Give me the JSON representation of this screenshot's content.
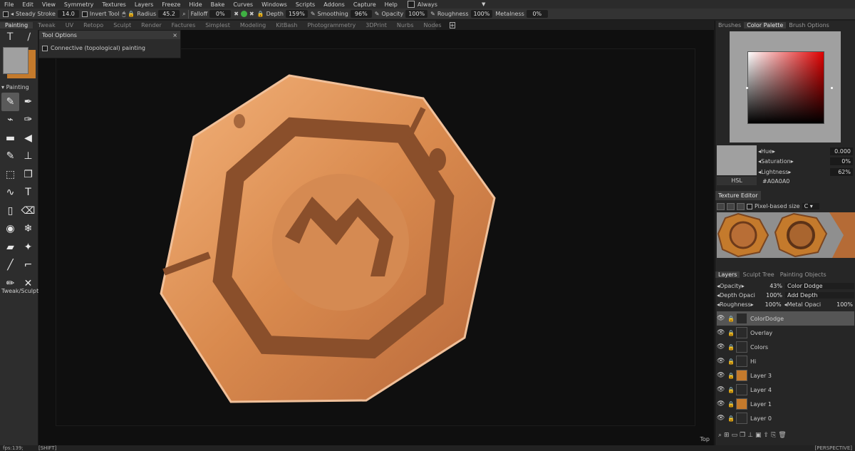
{
  "menubar": {
    "items": [
      "File",
      "Edit",
      "View",
      "Symmetry",
      "Textures",
      "Layers",
      "Freeze",
      "Hide",
      "Bake",
      "Curves",
      "Windows",
      "Scripts",
      "Addons",
      "Capture",
      "Help"
    ],
    "always_label": "Always"
  },
  "toolbar": {
    "steady_stroke_label": "Steady  Stroke",
    "steady_stroke_value": "14.0",
    "invert_tool_label": "Invert  Tool",
    "radius_label": "Radius",
    "radius_value": "45.2",
    "falloff_label": "Falloff",
    "falloff_value": "0%",
    "depth_label": "Depth",
    "depth_value": "159%",
    "smoothing_label": "Smoothing",
    "smoothing_value": "96%",
    "opacity_label": "Opacity",
    "opacity_value": "100%",
    "roughness_label": "Roughness",
    "roughness_value": "100%",
    "metalness_label": "Metalness",
    "metalness_value": "0%"
  },
  "room_tabs": [
    "Painting",
    "Tweak",
    "UV",
    "Retopo",
    "Sculpt",
    "Render",
    "Factures",
    "Simplest",
    "Modeling",
    "KitBash",
    "Photogrammetry",
    "3DPrint",
    "Nurbs",
    "Nodes"
  ],
  "left_panel": {
    "painting_label": "Painting",
    "tweak_label": "Tweak/Sculpt",
    "colors": {
      "primary": "#A0A0A0",
      "secondary": "#C47A2C"
    }
  },
  "tool_options": {
    "title": "Tool  Options",
    "connective_label": "Connective  (topological)  painting"
  },
  "viewport": {
    "top_label": "Top"
  },
  "right_panel": {
    "tabs": [
      "Brushes",
      "Color  Palette",
      "Brush  Options"
    ],
    "hsl": [
      {
        "label": "Hue",
        "value": "0.000"
      },
      {
        "label": "Saturation",
        "value": "0%"
      },
      {
        "label": "Lightness",
        "value": "62%"
      }
    ],
    "hsl_label": "HSL",
    "hex": "#A0A0A0",
    "texture_editor": {
      "title": "Texture  Editor",
      "pixel_based_label": "Pixel-based  size",
      "channel": "C"
    },
    "layer_tabs": [
      "Layers",
      "Sculpt  Tree",
      "Painting  Objects"
    ],
    "layer_props": [
      {
        "l1": "Opacity",
        "v1": "43%",
        "l2": "Color  Dodge",
        "v2": ""
      },
      {
        "l1": "Depth  Opaci",
        "v1": "100%",
        "l2": "Add  Depth",
        "v2": ""
      },
      {
        "l1": "Roughness",
        "v1": "100%",
        "l2": "Metal  Opaci",
        "v2": "100%"
      }
    ],
    "layers": [
      {
        "name": "ColorDodge"
      },
      {
        "name": "Overlay"
      },
      {
        "name": "Colors"
      },
      {
        "name": "Hi"
      },
      {
        "name": "Layer  3"
      },
      {
        "name": "Layer  4"
      },
      {
        "name": "Layer  1"
      },
      {
        "name": "Layer  0"
      }
    ]
  },
  "status": {
    "fps": "fps:139;",
    "shift": "[SHIFT]",
    "perspective": "[PERSPECTIVE]"
  }
}
